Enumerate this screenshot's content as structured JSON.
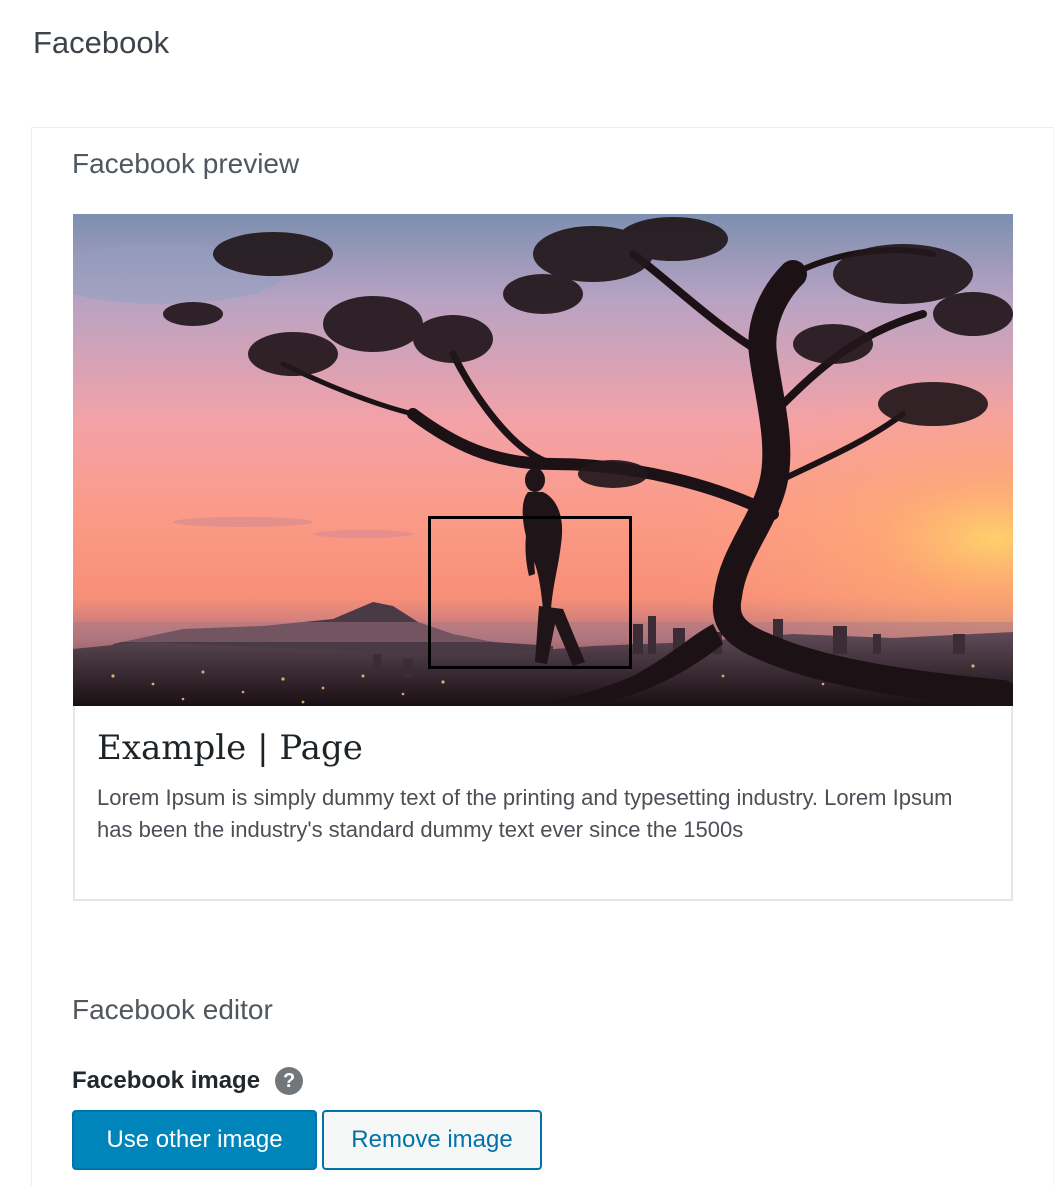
{
  "section": {
    "title": "Facebook"
  },
  "preview": {
    "heading": "Facebook preview",
    "card": {
      "title": "Example | Page",
      "description": "Lorem Ipsum is simply dummy text of the printing and typesetting industry. Lorem Ipsum has been the industry's standard dummy text ever since the 1500s"
    }
  },
  "editor": {
    "heading": "Facebook editor",
    "image_label": "Facebook image",
    "help_icon_glyph": "?",
    "buttons": {
      "use_other_image": "Use other image",
      "remove_image": "Remove image"
    }
  },
  "colors": {
    "primary_button": "#0085ba",
    "secondary_button_border": "#0073aa",
    "help_icon": "#72777c"
  },
  "icons": {
    "help": "question-mark-circle-icon"
  }
}
